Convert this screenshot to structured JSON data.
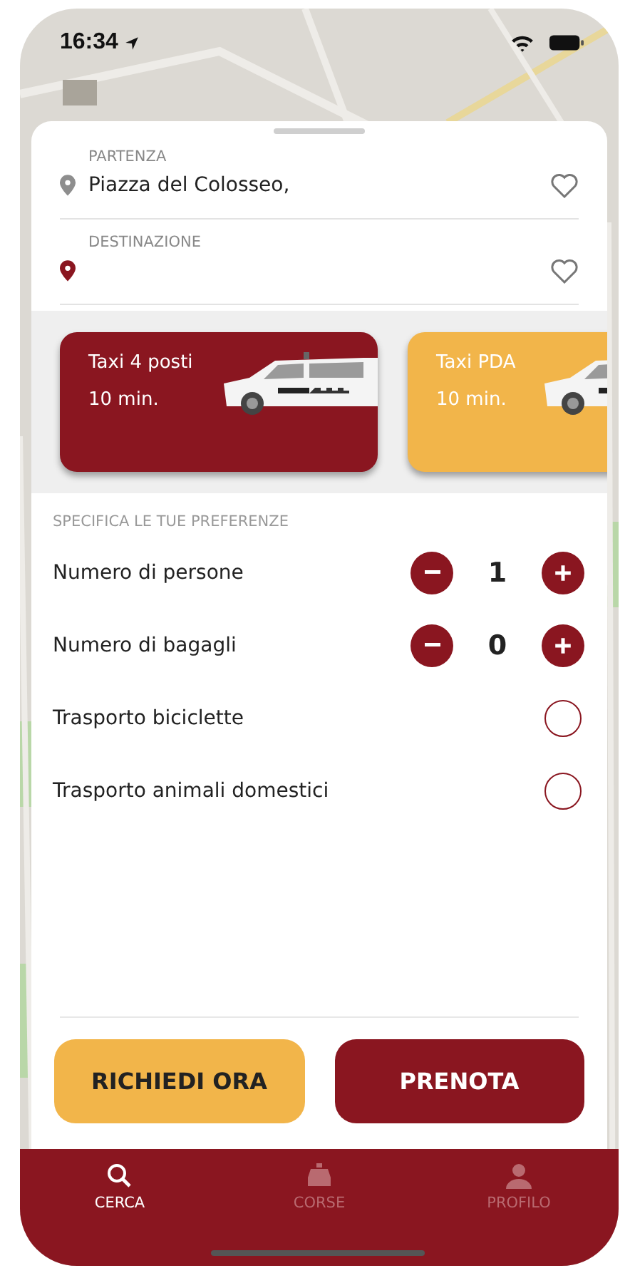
{
  "status_bar": {
    "time": "16:34"
  },
  "route": [
    {
      "kind": "origin",
      "label": "PARTENZA",
      "value": "Piazza del Colosseo,"
    },
    {
      "kind": "destination",
      "label": "DESTINAZIONE"
    }
  ],
  "vehicles": [
    {
      "name": "Taxi 4 posti",
      "eta": "10 min.",
      "selected": true
    },
    {
      "name": "Taxi PDA",
      "eta": "10 min.",
      "selected": false
    }
  ],
  "preferences": {
    "heading": "SPECIFICA LE TUE PREFERENZE",
    "items": [
      {
        "kind": "counter",
        "label": "Numero di persone",
        "value": "1"
      },
      {
        "kind": "counter",
        "label": "Numero di bagagli",
        "value": "0"
      },
      {
        "kind": "toggle",
        "label": "Trasporto biciclette",
        "checked": false
      },
      {
        "kind": "toggle",
        "label": "Trasporto animali domestici",
        "checked": false
      }
    ]
  },
  "actions": [
    {
      "kind": "secondary",
      "label": "RICHIEDI ORA"
    },
    {
      "kind": "primary",
      "label": "PRENOTA"
    }
  ],
  "tabs": [
    {
      "label": "CERCA",
      "selected": true
    },
    {
      "label": "CORSE",
      "selected": false
    },
    {
      "label": "PROFILO",
      "selected": false
    }
  ]
}
